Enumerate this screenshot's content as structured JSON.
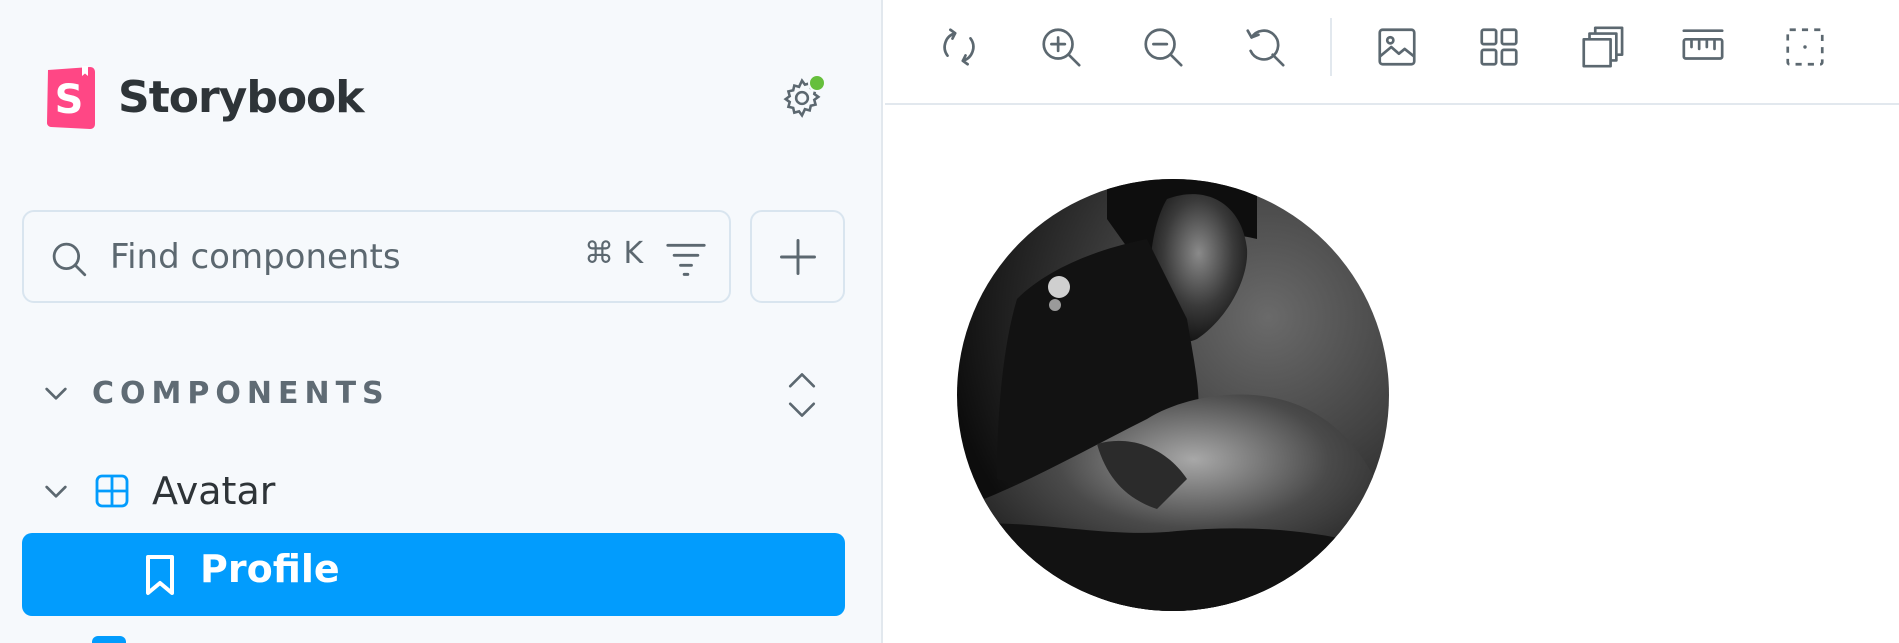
{
  "brand": {
    "name": "Storybook",
    "logo_letter": "S",
    "logo_color": "#ff4785"
  },
  "sidebar": {
    "settings_icon": "gear-icon",
    "settings_status_color": "#66bf3c",
    "search": {
      "placeholder": "Find components",
      "shortcut": "⌘ K"
    },
    "section": {
      "title": "COMPONENTS"
    },
    "tree": {
      "component": {
        "label": "Avatar",
        "icon": "component-icon"
      },
      "story": {
        "label": "Profile",
        "icon": "bookmark-icon",
        "selected": true
      }
    },
    "accent_color": "#029cfd"
  },
  "toolbar": {
    "tools": [
      {
        "name": "remount-icon"
      },
      {
        "name": "zoom-in-icon"
      },
      {
        "name": "zoom-out-icon"
      },
      {
        "name": "reset-zoom-icon"
      },
      {
        "name": "background-icon"
      },
      {
        "name": "grid-icon"
      },
      {
        "name": "viewport-icon"
      },
      {
        "name": "measure-icon"
      },
      {
        "name": "outline-icon"
      }
    ]
  },
  "canvas": {
    "content": "avatar-image"
  }
}
